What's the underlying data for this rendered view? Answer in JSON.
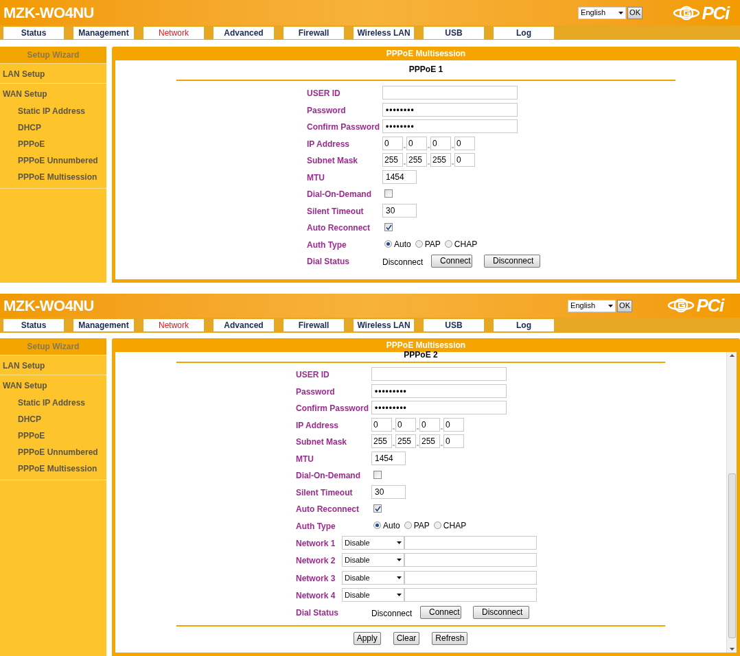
{
  "screens": [
    {
      "header": {
        "title": "MZK-WO4NU",
        "language": "English",
        "ok_button": "OK",
        "logo": "PCi"
      },
      "nav": [
        {
          "label": "Status",
          "selected": false
        },
        {
          "label": "Management",
          "selected": false
        },
        {
          "label": "Network",
          "selected": true
        },
        {
          "label": "Advanced",
          "selected": false
        },
        {
          "label": "Firewall",
          "selected": false
        },
        {
          "label": "Wireless LAN",
          "selected": false
        },
        {
          "label": "USB",
          "selected": false
        },
        {
          "label": "Log",
          "selected": false
        }
      ],
      "sidebar": {
        "title": "Setup Wizard",
        "items": [
          {
            "label": "LAN Setup"
          },
          {
            "label": "WAN Setup",
            "children": [
              {
                "label": "Static IP Address"
              },
              {
                "label": "DHCP"
              },
              {
                "label": "PPPoE"
              },
              {
                "label": "PPPoE Unnumbered"
              },
              {
                "label": "PPPoE Multisession"
              }
            ]
          }
        ]
      },
      "panel": {
        "title": "PPPoE Multisession",
        "subtitle": "PPPoE 1",
        "scrollbar": false,
        "fields": [
          {
            "kind": "text",
            "label": "USER ID"
          },
          {
            "kind": "text",
            "label": "Password",
            "value": "••••••••"
          },
          {
            "kind": "text",
            "label": "Confirm Password",
            "value": "••••••••"
          },
          {
            "kind": "ip",
            "label": "IP Address",
            "octets": [
              "0",
              "0",
              "0",
              "0"
            ]
          },
          {
            "kind": "ip",
            "label": "Subnet Mask",
            "octets": [
              "255",
              "255",
              "255",
              "0"
            ]
          },
          {
            "kind": "short",
            "label": "MTU",
            "value": "1454"
          },
          {
            "kind": "checkbox",
            "label": "Dial-On-Demand",
            "checked": false
          },
          {
            "kind": "short",
            "label": "Silent Timeout",
            "value": "30"
          },
          {
            "kind": "checkbox",
            "label": "Auto Reconnect",
            "checked": true
          },
          {
            "kind": "radio",
            "label": "Auth Type",
            "options": [
              {
                "label": "Auto",
                "selected": true
              },
              {
                "label": "PAP",
                "selected": false
              },
              {
                "label": "CHAP",
                "selected": false
              }
            ]
          },
          {
            "kind": "status",
            "label": "Dial Status",
            "value": "Disconnect",
            "buttons": [
              "Connect",
              "Disconnect"
            ]
          }
        ]
      }
    },
    {
      "header": {
        "title": "MZK-WO4NU",
        "language": "English",
        "ok_button": "OK",
        "logo": "PCi"
      },
      "nav": [
        {
          "label": "Status",
          "selected": false
        },
        {
          "label": "Management",
          "selected": false
        },
        {
          "label": "Network",
          "selected": true
        },
        {
          "label": "Advanced",
          "selected": false
        },
        {
          "label": "Firewall",
          "selected": false
        },
        {
          "label": "Wireless LAN",
          "selected": false
        },
        {
          "label": "USB",
          "selected": false
        },
        {
          "label": "Log",
          "selected": false
        }
      ],
      "sidebar": {
        "title": "Setup Wizard",
        "items": [
          {
            "label": "LAN Setup"
          },
          {
            "label": "WAN Setup",
            "children": [
              {
                "label": "Static IP Address"
              },
              {
                "label": "DHCP"
              },
              {
                "label": "PPPoE"
              },
              {
                "label": "PPPoE Unnumbered"
              },
              {
                "label": "PPPoE Multisession"
              }
            ]
          }
        ]
      },
      "panel": {
        "title": "PPPoE Multisession",
        "subtitle": "PPPoE 2",
        "scrollbar": true,
        "fields": [
          {
            "kind": "text",
            "label": "USER ID"
          },
          {
            "kind": "text",
            "label": "Password",
            "value": "•••••••••"
          },
          {
            "kind": "text",
            "label": "Confirm Password",
            "value": "•••••••••"
          },
          {
            "kind": "ip",
            "label": "IP Address",
            "octets": [
              "0",
              "0",
              "0",
              "0"
            ]
          },
          {
            "kind": "ip",
            "label": "Subnet Mask",
            "octets": [
              "255",
              "255",
              "255",
              "0"
            ]
          },
          {
            "kind": "short",
            "label": "MTU",
            "value": "1454"
          },
          {
            "kind": "checkbox",
            "label": "Dial-On-Demand",
            "checked": false
          },
          {
            "kind": "short",
            "label": "Silent Timeout",
            "value": "30"
          },
          {
            "kind": "checkbox",
            "label": "Auto Reconnect",
            "checked": true
          },
          {
            "kind": "radio",
            "label": "Auth Type",
            "options": [
              {
                "label": "Auto",
                "selected": true
              },
              {
                "label": "PAP",
                "selected": false
              },
              {
                "label": "CHAP",
                "selected": false
              }
            ]
          },
          {
            "kind": "network",
            "label": "Network 1",
            "value": "Disable"
          },
          {
            "kind": "network",
            "label": "Network 2",
            "value": "Disable"
          },
          {
            "kind": "network",
            "label": "Network 3",
            "value": "Disable"
          },
          {
            "kind": "network",
            "label": "Network 4",
            "value": "Disable"
          },
          {
            "kind": "status",
            "label": "Dial Status",
            "value": "Disconnect",
            "buttons": [
              "Connect",
              "Disconnect"
            ]
          }
        ],
        "actions": [
          "Apply",
          "Clear",
          "Refresh"
        ]
      }
    }
  ]
}
